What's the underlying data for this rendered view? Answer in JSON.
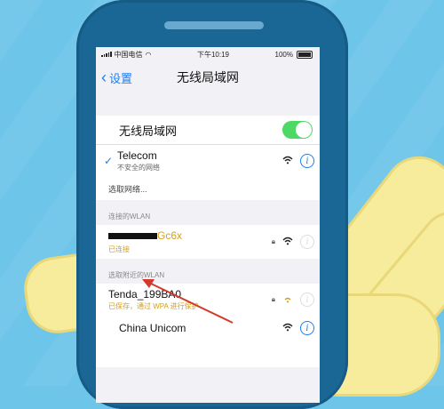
{
  "status_bar": {
    "carrier": "中国电信",
    "time": "下午10:19",
    "battery": "100%"
  },
  "nav": {
    "back_label": "设置",
    "title": "无线局域网"
  },
  "wifi": {
    "label": "无线局域网",
    "enabled": true
  },
  "current_network": {
    "name": "Telecom",
    "subtitle": "不安全的网络"
  },
  "choose_network": "选取网络...",
  "connected_section": {
    "header": "连接的WLAN",
    "network": {
      "name_visible_suffix": "Gc6x",
      "status": "已连接"
    }
  },
  "nearby_section": {
    "header": "选取附近的WLAN",
    "networks": [
      {
        "name": "Tenda_199BA0",
        "subtitle": "已保存，通过 WPA 进行保护"
      },
      {
        "name": "China Unicom"
      }
    ]
  },
  "colors": {
    "accent": "#1e7cf2",
    "toggle_on": "#4cd964",
    "annotation": "#d23b2a",
    "highlight_text": "#d4a017"
  },
  "icons": [
    "chevron-left-icon",
    "checkmark-icon",
    "wifi-icon",
    "info-icon",
    "lock-icon",
    "arrow-annotation"
  ]
}
